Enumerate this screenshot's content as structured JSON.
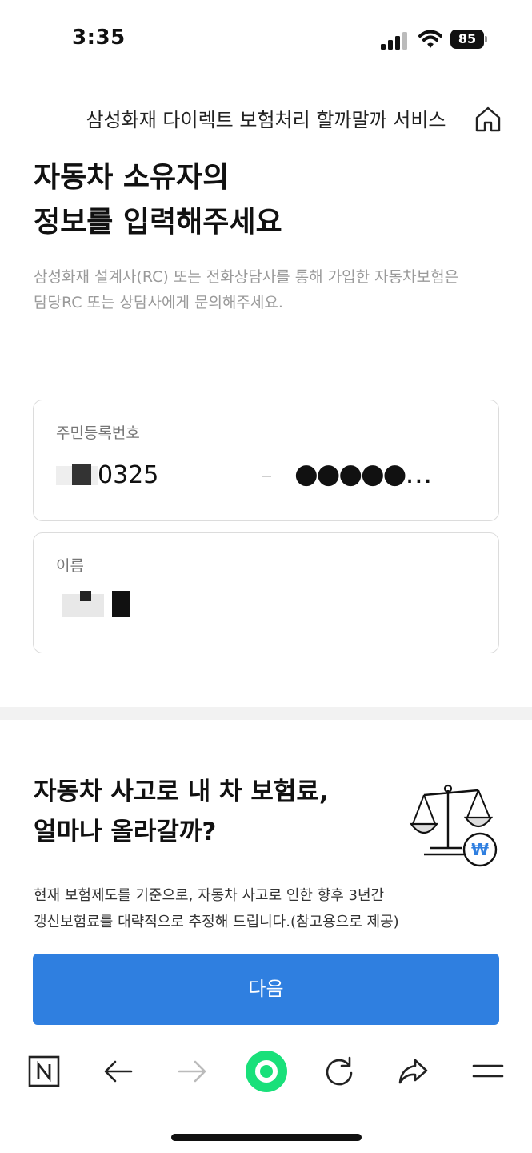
{
  "status_bar": {
    "time": "3:35",
    "battery": "85",
    "icons": [
      "signal-icon",
      "wifi-icon",
      "battery-icon"
    ]
  },
  "header": {
    "title": "삼성화재 다이렉트 보험처리 할까말까 서비스",
    "home_icon": "home-icon"
  },
  "main": {
    "title": "자동차 소유자의\n정보를 입력해주세요",
    "notice": "삼성화재 설계사(RC) 또는 전화상담사를 통해 가입한 자동차보험은\n담당RC 또는 상담사에게 문의해주세요.",
    "rrn_field": {
      "label": "주민등록번호",
      "front_value": "0325",
      "back_value": "●●●●●…"
    },
    "name_field": {
      "label": "이름"
    }
  },
  "section": {
    "title": "자동차 사고로 내 차 보험료,\n얼마나 올라갈까?",
    "description": "현재 보험제도를 기준으로, 자동차 사고로 인한 향후 3년간\n갱신보험료를 대략적으로 추정해 드립니다.(참고용으로 제공)",
    "illustration": "scale-won-icon"
  },
  "next_button": {
    "label": "다음"
  },
  "toolbar": {
    "items": [
      "naver-n-icon",
      "back-arrow-icon",
      "forward-arrow-icon",
      "green-dot-icon",
      "reload-icon",
      "share-icon",
      "menu-icon"
    ]
  },
  "colors": {
    "primary_button": "#2f7fe0",
    "green_button": "#19e07a",
    "divider": "#f2f2f2",
    "field_border": "#dcdcdc"
  }
}
